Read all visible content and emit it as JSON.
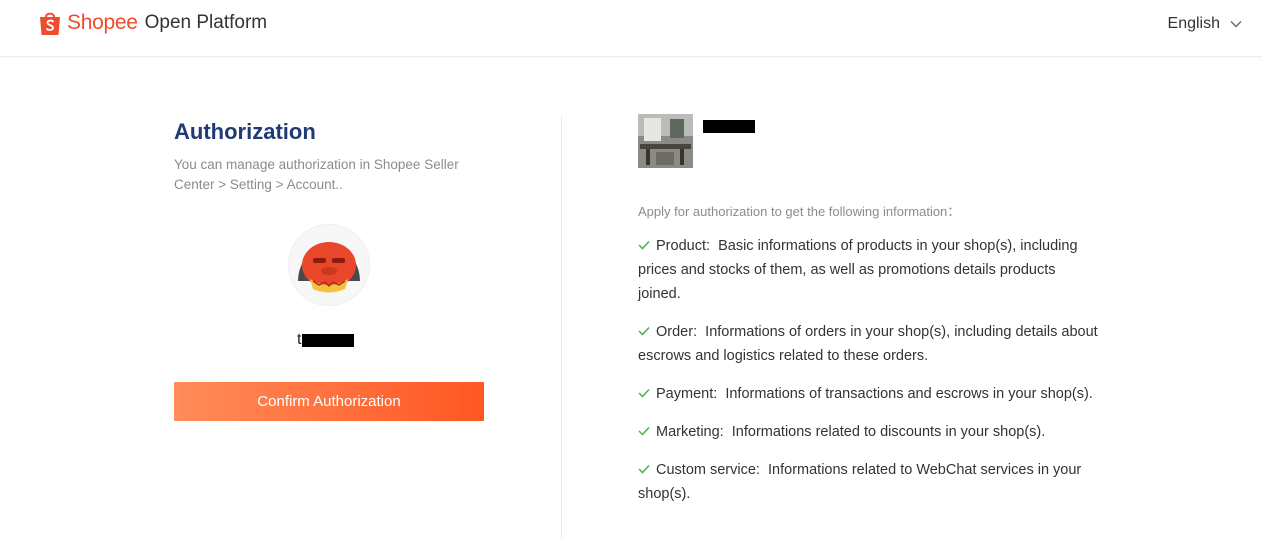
{
  "header": {
    "brand": "Shopee",
    "product": "Open Platform",
    "language": "English"
  },
  "auth": {
    "title": "Authorization",
    "description": "You can manage authorization in Shopee Seller Center > Setting > Account..",
    "username_visible": "t",
    "confirm_label": "Confirm Authorization"
  },
  "app": {
    "apply_text": "Apply for authorization to get the following information：",
    "permissions": [
      {
        "name": "Product",
        "text": "Basic informations of products in your shop(s), including prices and stocks of them, as well as promotions details products joined."
      },
      {
        "name": "Order",
        "text": "Informations of orders in your shop(s), including details about escrows and logistics related to these orders."
      },
      {
        "name": "Payment",
        "text": "Informations of transactions and escrows in your shop(s)."
      },
      {
        "name": "Marketing",
        "text": "Informations related to discounts in your shop(s)."
      },
      {
        "name": "Custom service",
        "text": "Informations related to WebChat services in your shop(s)."
      }
    ]
  },
  "colors": {
    "brand": "#ee4d2d",
    "title": "#203a73",
    "check": "#4caf50",
    "button_start": "#ff8c5a",
    "button_end": "#ff5722"
  }
}
